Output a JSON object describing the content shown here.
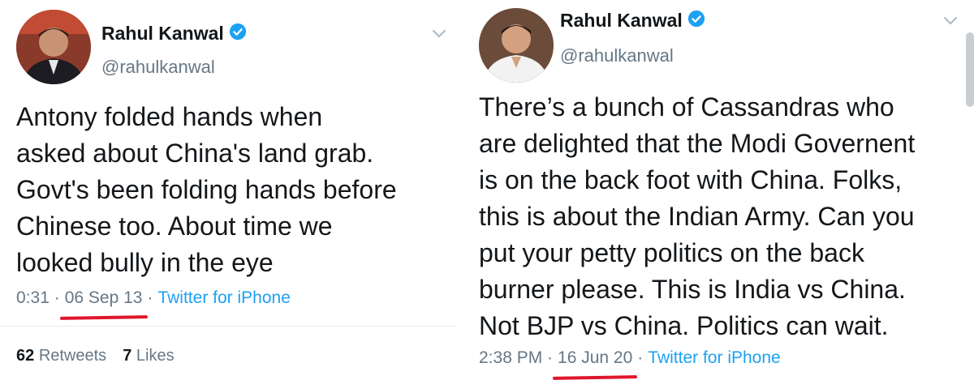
{
  "tweets": [
    {
      "author_name": "Rahul Kanwal",
      "handle": "@rahulkanwal",
      "text": "Antony folded hands when\nasked about China's land grab.\nGovt's been folding hands before\nChinese too. About time we\nlooked bully in the eye",
      "time": "0:31 ·",
      "date": "06 Sep 13",
      "sep": "·",
      "source": "Twitter for iPhone",
      "retweets_count": "62",
      "retweets_label": "Retweets",
      "likes_count": "7",
      "likes_label": "Likes"
    },
    {
      "author_name": "Rahul Kanwal",
      "handle": "@rahulkanwal",
      "text": "There’s a bunch of Cassandras who\nare delighted that the Modi Governent\nis on the back foot with China. Folks,\nthis is about the Indian Army. Can you\nput your petty politics on the back\nburner please. This is India vs China.\nNot BJP vs China. Politics can wait.",
      "time": "2:38 PM ·",
      "date": "16 Jun 20",
      "sep": "·",
      "source": "Twitter for iPhone"
    }
  ],
  "colors": {
    "verified": "#1da1f2",
    "underline": "#e0162b",
    "link": "#1da1f2",
    "muted": "#657786"
  },
  "icons": [
    "verified-badge-icon",
    "chevron-down-icon"
  ]
}
